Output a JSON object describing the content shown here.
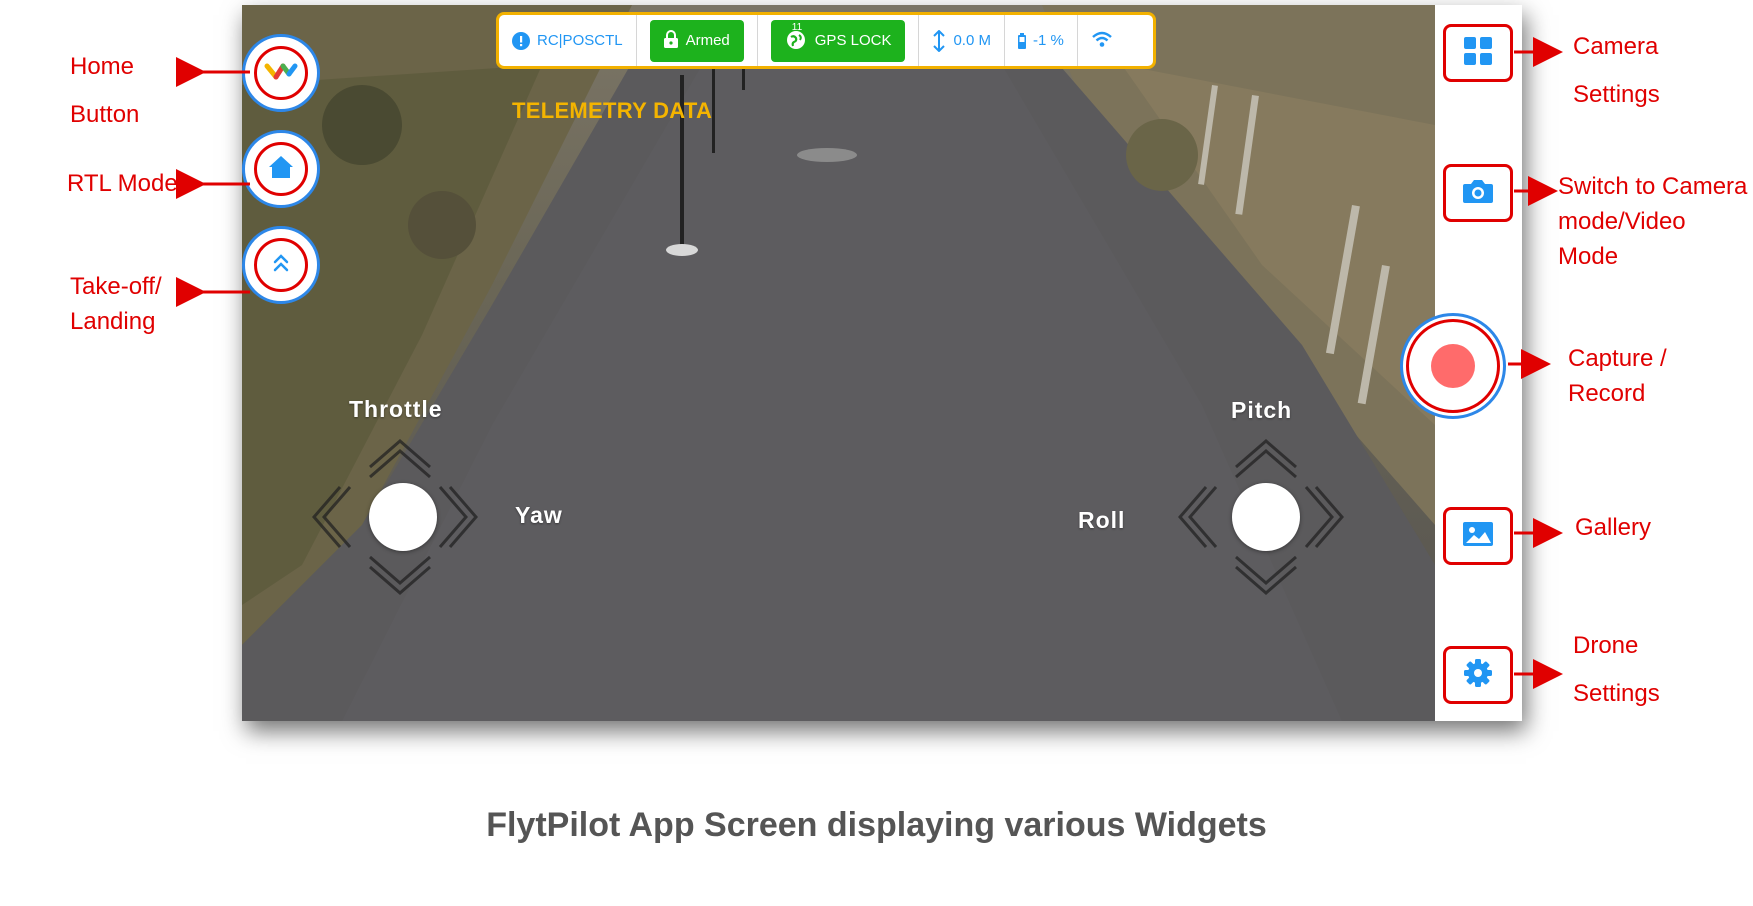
{
  "telemetry": {
    "mode": "RC|POSCTL",
    "armed": "Armed",
    "gps_satellites": "11",
    "gps": "GPS LOCK",
    "altitude": "0.0 M",
    "battery": "-1 %"
  },
  "telemetry_caption": "TELEMETRY DATA",
  "joysticks": {
    "throttle": "Throttle",
    "yaw": "Yaw",
    "pitch": "Pitch",
    "roll": "Roll"
  },
  "annotations": {
    "home_line1": "Home",
    "home_line2": "Button",
    "rtl": "RTL Mode",
    "takeoff_line1": "Take-off/",
    "takeoff_line2": "Landing",
    "camera_settings_line1": "Camera",
    "camera_settings_line2": "Settings",
    "switch_line1": "Switch to Camera",
    "switch_line2": "mode/Video",
    "switch_line3": "Mode",
    "capture_line1": "Capture /",
    "capture_line2": "Record",
    "gallery": "Gallery",
    "drone_settings_line1": "Drone",
    "drone_settings_line2": "Settings"
  },
  "caption": "FlytPilot App Screen displaying various Widgets",
  "colors": {
    "accent_blue": "#2196f3",
    "annotation_red": "#e00000",
    "telemetry_border": "#f2b100",
    "armed_green": "#1db21d",
    "record_dot": "#ff6b6b"
  },
  "icons": {
    "home_button": "flytbase-logo-icon",
    "rtl": "home-icon",
    "takeoff": "double-chevron-up-icon",
    "camera_settings": "grid-icon",
    "switch_mode": "camera-icon",
    "gallery": "image-icon",
    "drone_settings": "gear-icon",
    "mode": "info-icon",
    "armed": "lock-icon",
    "gps": "globe-icon",
    "altitude": "vertical-arrows-icon",
    "battery": "battery-icon",
    "signal": "wifi-icon"
  }
}
